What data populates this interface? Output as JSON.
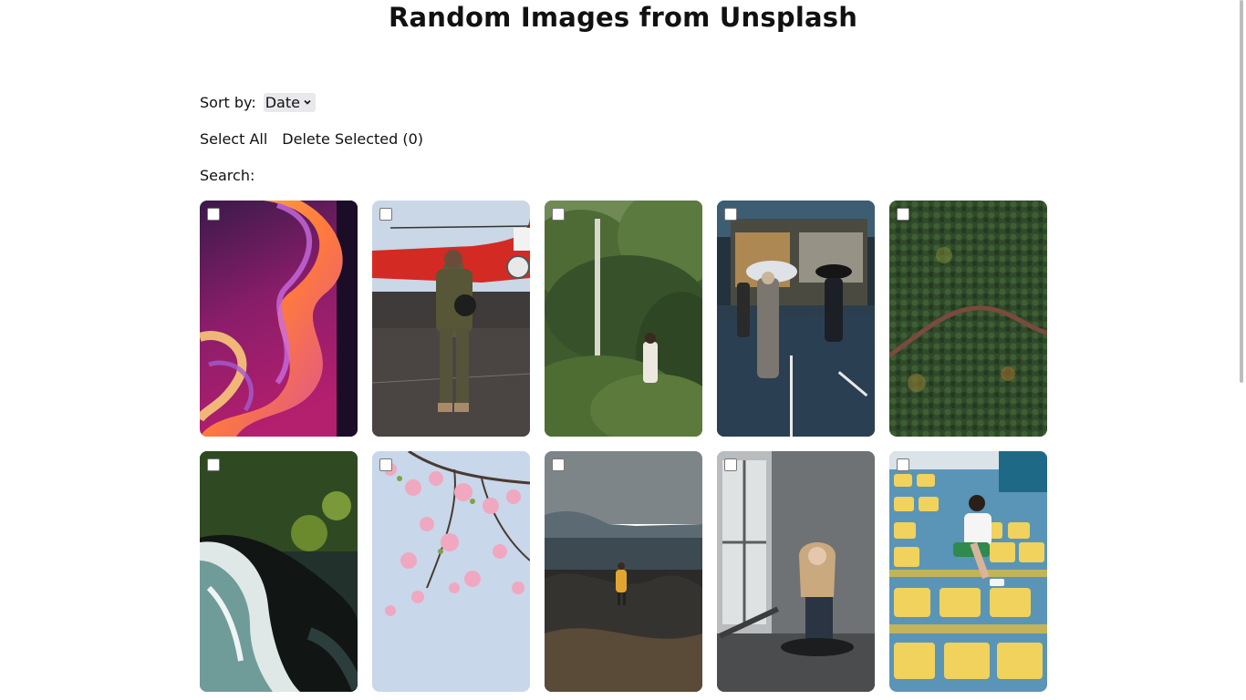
{
  "header": {
    "title": "Random Images from Unsplash"
  },
  "controls": {
    "sort_label": "Sort by:",
    "sort_value": "Date",
    "select_all": "Select All",
    "delete_selected": "Delete Selected (0)",
    "search_label": "Search:",
    "search_value": ""
  },
  "images": [
    {
      "subject": "abstract-3d-swirl",
      "selected": false
    },
    {
      "subject": "pilot-with-helicopter",
      "selected": false
    },
    {
      "subject": "woman-in-green-field",
      "selected": false
    },
    {
      "subject": "rainy-city-street",
      "selected": false
    },
    {
      "subject": "aerial-forest-road",
      "selected": false
    },
    {
      "subject": "aerial-coast-waves",
      "selected": false
    },
    {
      "subject": "cherry-blossoms",
      "selected": false
    },
    {
      "subject": "person-on-black-beach",
      "selected": false
    },
    {
      "subject": "woman-sitting-by-window",
      "selected": false
    },
    {
      "subject": "woman-in-stadium-seats",
      "selected": false
    }
  ]
}
